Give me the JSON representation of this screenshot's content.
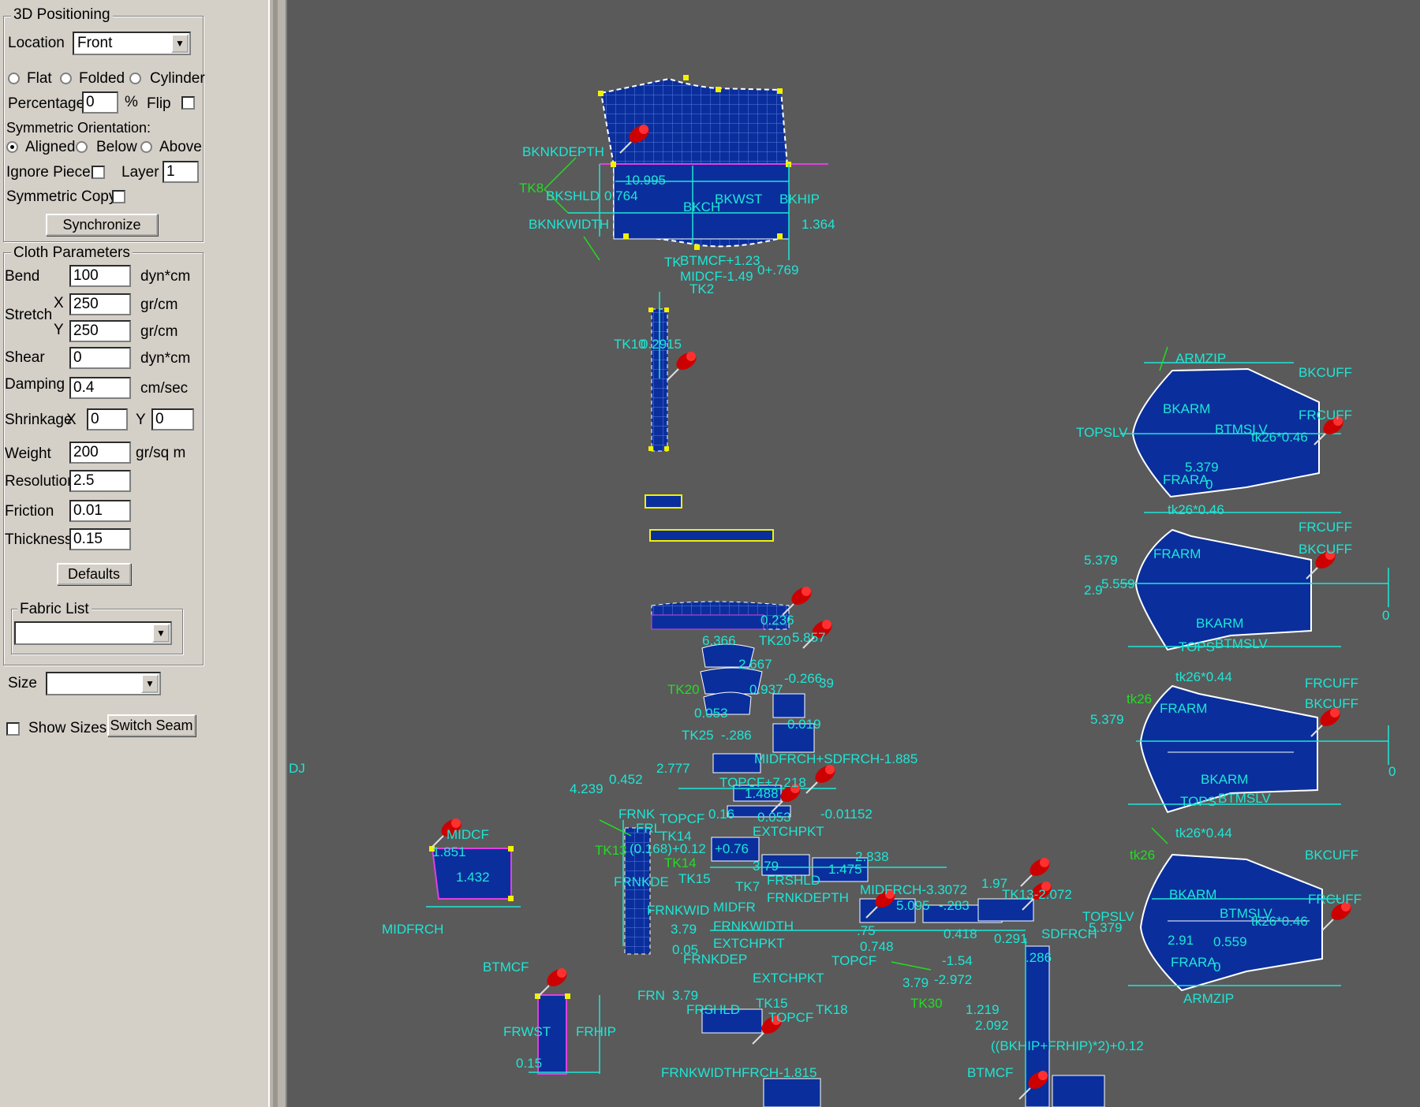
{
  "positioning": {
    "title": "3D Positioning",
    "location_label": "Location",
    "location_value": "Front",
    "mode_flat": "Flat",
    "mode_folded": "Folded",
    "mode_cylinder": "Cylinder",
    "percentage_label": "Percentage",
    "percentage_value": "0",
    "percent_sign": "%",
    "flip_label": "Flip",
    "sym_orientation_label": "Symmetric Orientation:",
    "orient_aligned": "Aligned",
    "orient_below": "Below",
    "orient_above": "Above",
    "ignore_piece_label": "Ignore Piece",
    "layer_label": "Layer",
    "layer_value": "1",
    "symmetric_copy_label": "Symmetric Copy",
    "synchronize_label": "Synchronize"
  },
  "cloth": {
    "title": "Cloth Parameters",
    "bend_label": "Bend",
    "bend_value": "100",
    "bend_unit": "dyn*cm",
    "stretch_label": "Stretch",
    "stretch_x_label": "X",
    "stretch_x_value": "250",
    "stretch_x_unit": "gr/cm",
    "stretch_y_label": "Y",
    "stretch_y_value": "250",
    "stretch_y_unit": "gr/cm",
    "shear_label": "Shear",
    "shear_value": "0",
    "shear_unit": "dyn*cm",
    "damping_label": "Damping",
    "damping_value": "0.4",
    "damping_unit": "cm/sec",
    "shrinkage_label": "Shrinkage",
    "shrink_x_label": "X",
    "shrink_x_value": "0",
    "shrink_y_label": "Y",
    "shrink_y_value": "0",
    "weight_label": "Weight",
    "weight_value": "200",
    "weight_unit": "gr/sq m",
    "resolution_label": "Resolution",
    "resolution_value": "2.5",
    "friction_label": "Friction",
    "friction_value": "0.01",
    "thickness_label": "Thickness",
    "thickness_value": "0.15",
    "defaults_label": "Defaults",
    "fabric_list_label": "Fabric List",
    "fabric_list_value": ""
  },
  "bottom": {
    "size_label": "Size",
    "size_value": "",
    "show_sizes_label": "Show Sizes",
    "switch_seam_label": "Switch Seam"
  },
  "colors": {
    "canvas_bg": "#5a5a5a",
    "piece_fill": "#0a2f9c",
    "dimension": "#1ee6d6",
    "tack": "#22dd22",
    "point": "#f2f200",
    "pin": "#cc0000"
  },
  "canvas_labels": {
    "bknkdepth": "BKNKDEPTH",
    "tk8": "TK8",
    "bkshld": "BKSHLD",
    "v0764": "0.764",
    "v10995": "10.995",
    "bkch": "BKCH",
    "bkwst": "BKWST",
    "bkhip": "BKHIP",
    "bknkwidth": "BKNKWIDTH",
    "v1364": "1.364",
    "btmcf123": "BTMCF+1.23",
    "midcf149": "MIDCF-1.49",
    "v0769": "0+.769",
    "tk2": "TK2",
    "tk": "TK",
    "tk10": "TK10",
    "v02915": "0.2915",
    "v0236": "0.236",
    "v6366": "6.366",
    "tk20a": "TK20",
    "v5857": "5.857",
    "v2667": "2.667",
    "v0266": "-0.266",
    "v39": "39",
    "tk20b": "TK20",
    "v0937": "0.937",
    "v0053": "0.053",
    "v0019": "0.019",
    "tk25": "TK25",
    "v286": "-.286",
    "midfrch": "MIDFRCH+SDFRCH-1.885",
    "v2777": "2.777",
    "topcf7218": "TOPCF+7.218",
    "v1488": "1.488",
    "v4239": "4.239",
    "v0452": "0.452",
    "frnk": "FRNK",
    "topcf": "TOPCF",
    "v016": "0.16",
    "v0053b": "0.053",
    "v001152": "-0.01152",
    "frl": "FRL",
    "tk14": "TK14",
    "extchpkt": "EXTCHPKT",
    "tk13": "TK13",
    "v0168": "(0.168)+0.12",
    "v076": "+0.76",
    "v2838": "2.838",
    "tk14b": "TK14",
    "v379": "3.79",
    "v1475": "1.475",
    "frnkde": "FRNKDE",
    "tk15": "TK15",
    "tk7": "TK7",
    "frshld": "FRSHLD",
    "midfrch3": "MIDFRCH-3.3072",
    "v197": "1.97",
    "tk13b": "TK13-2.072",
    "frnkwid": "FRNKWID",
    "midfr": "MIDFR",
    "frnkdepth": "FRNKDEPTH",
    "v5095": "5.095",
    "v283": "-.283",
    "v379b": "3.79",
    "frnkwidth": "FRNKWIDTH",
    "v418": "0.418",
    "v0291": "0.291",
    "sdfrch": "SDFRCH",
    "extchpkt2": "EXTCHPKT",
    "v75": ".75",
    "v0748": "0.748",
    "v0056": "0.05",
    "frnkdep": "FRNKDEP",
    "v154": "-1.54",
    "v0286": ".286",
    "topcf2": "TOPCF",
    "extchpkt3": "EXTCHPKT",
    "v379c": "3.79",
    "v2972": "-2.972",
    "frn": "FRN",
    "v379d": "3.79",
    "frshld2": "FRSHLD",
    "tk15b": "TK15",
    "tk18": "TK18",
    "topcf3": "TOPCF",
    "tk30": "TK30",
    "v1219": "1.219",
    "v2092": "2.092",
    "bkhipfrhip": "((BKHIP+FRHIP)*2)+0.12",
    "frnkwidthfrch": "FRNKWIDTHFRCH-1.815",
    "btmcf": "BTMCF",
    "midcf": "MIDCF",
    "v1851": "1.851",
    "v1432": "1.432",
    "midfrch2": "MIDFRCH",
    "btmcf2": "BTMCF",
    "frwst": "FRWST",
    "frhip": "FRHIP",
    "v015": "0.15",
    "dj": "DJ",
    "armzip": "ARMZIP",
    "bkcuff": "BKCUFF",
    "bkarm": "BKARM",
    "frcuff": "FRCUFF",
    "topslv": "TOPSLV",
    "btmslv": "BTMSLV",
    "tk26046": "tk26*0.46",
    "v5379": "5.379",
    "frara": "FRARA",
    "zero": "0",
    "tk26046b": "tk26*0.46",
    "frcuff2": "FRCUFF",
    "bkcuff2": "BKCUFF",
    "frarm": "FRARM",
    "v5559": "5.559",
    "v2": "2.9",
    "bkarm2": "BKARM",
    "topslv2": "TOPS",
    "btmslv2": "BTMSLV",
    "tk26044": "tk26*0.44",
    "frcuff3": "FRCUFF",
    "bkcuff3": "BKCUFF",
    "tk26": "tk26",
    "frarm2": "FRARM",
    "v5379b": "5.379",
    "bkarm3": "BKARM",
    "topslv3": "TOPS",
    "btmslv3": "BTMSLV",
    "tk26044b": "tk26*0.44",
    "tk26b": "tk26",
    "bkcuff4": "BKCUFF",
    "bkarm4": "BKARM",
    "btmslv4": "BTMSLV",
    "frcuff4": "FRCUFF",
    "topslv4": "TOPSLV",
    "v5379c": "5.379",
    "tk26046c": "tk26*0.46",
    "v2910": "2.91",
    "v0559": "0.559",
    "frara2": "FRARA",
    "armzip2": "ARMZIP"
  }
}
